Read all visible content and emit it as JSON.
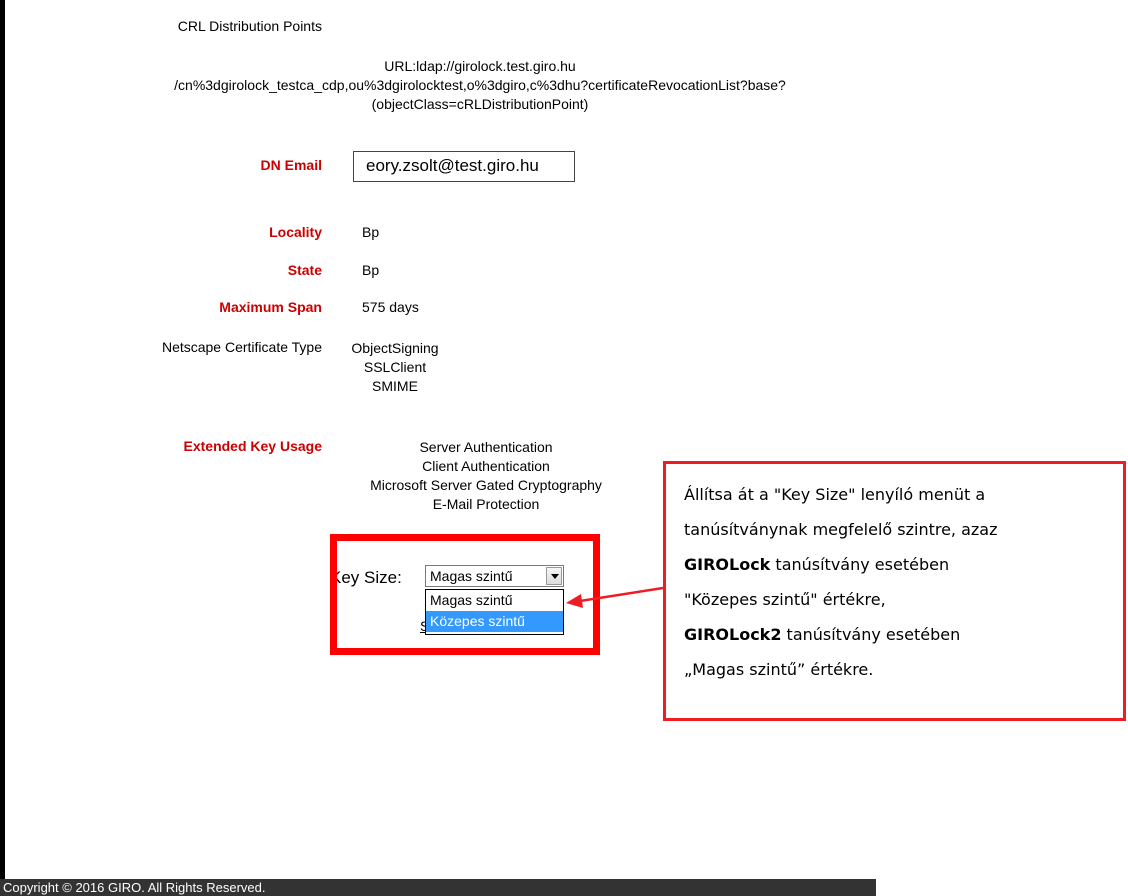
{
  "crl": {
    "label": "CRL Distribution Points",
    "line1": "URL:ldap://girolock.test.giro.hu",
    "line2": "/cn%3dgirolock_testca_cdp,ou%3dgirolocktest,o%3dgiro,c%3dhu?certificateRevocationList?base?",
    "line3": "(objectClass=cRLDistributionPoint)"
  },
  "dn_email": {
    "label": "DN Email",
    "value": "eory.zsolt@test.giro.hu"
  },
  "locality": {
    "label": "Locality",
    "value": "Bp"
  },
  "state": {
    "label": "State",
    "value": "Bp"
  },
  "max_span": {
    "label": "Maximum Span",
    "value": "575 days"
  },
  "netscape": {
    "label": "Netscape Certificate Type",
    "values": [
      "ObjectSigning",
      "SSLClient",
      "SMIME"
    ]
  },
  "eku": {
    "label": "Extended Key Usage",
    "values": [
      "Server Authentication",
      "Client Authentication",
      "Microsoft Server Gated Cryptography",
      "E-Mail Protection"
    ]
  },
  "key_size": {
    "label": "Key Size:",
    "selected": "Magas szintű",
    "options": [
      "Magas szintű",
      "Közepes szintű"
    ],
    "highlighted": "Közepes szintű",
    "hidden_char": "S"
  },
  "callout": {
    "line1": "Állítsa át a \"Key Size\" lenyíló menüt a",
    "line2": "tanúsítványnak megfelelő szintre, azaz",
    "line3_bold": "GIROLock",
    "line3_rest": " tanúsítvány esetében",
    "line4": "\"Közepes szintű\" értékre,",
    "line5_bold": "GIROLock2",
    "line5_rest": " tanúsítvány esetében",
    "line6": "„Magas szintű” értékre."
  },
  "footer": {
    "text": "Copyright © 2016 GIRO. All Rights Reserved."
  },
  "colors": {
    "label_red": "#cc0000",
    "annotation_red": "#ee1c24",
    "highlight_blue": "#3399ff",
    "footer_bg": "#333333"
  }
}
